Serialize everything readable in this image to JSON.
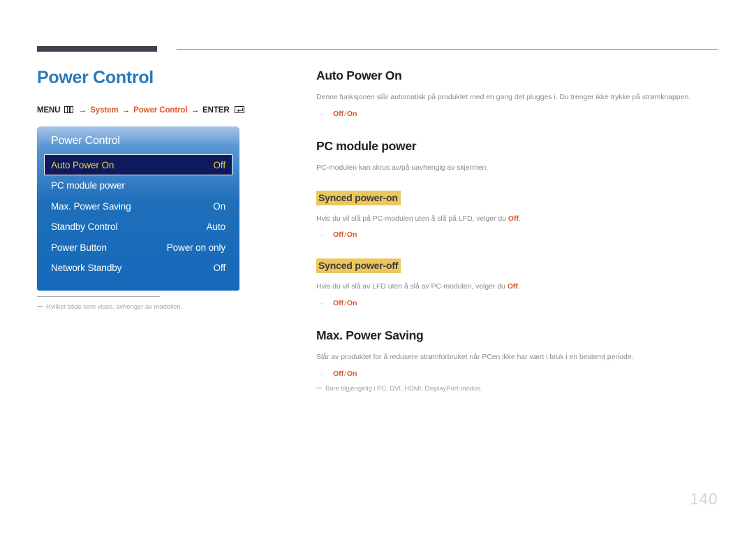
{
  "header": {
    "rule_color": "#454050"
  },
  "left": {
    "page_title": "Power Control",
    "breadcrumb": {
      "menu_label": "MENU",
      "menu_icon": "menu-grid-icon",
      "arrow": "→",
      "crumb1": "System",
      "crumb2": "Power Control",
      "enter_label": "ENTER",
      "enter_icon": "enter-return-icon"
    },
    "osd": {
      "title": "Power Control",
      "rows": [
        {
          "label": "Auto Power On",
          "value": "Off",
          "selected": true
        },
        {
          "label": "PC module power",
          "value": "",
          "selected": false
        },
        {
          "label": "Max. Power Saving",
          "value": "On",
          "selected": false
        },
        {
          "label": "Standby Control",
          "value": "Auto",
          "selected": false
        },
        {
          "label": "Power Button",
          "value": "Power on only",
          "selected": false
        },
        {
          "label": "Network Standby",
          "value": "Off",
          "selected": false
        }
      ],
      "accent_selected_bg": "#0d1a5c",
      "accent_selected_text": "#f5cf36",
      "panel_blue": "#1569ba"
    },
    "footnote": "Hvilket bilde som vises, avhenger av modellen."
  },
  "right": {
    "sections": [
      {
        "heading": "Auto Power On",
        "paragraph": "Denne funksjonen slår automatisk på produktet med en gang det plugges i. Du trenger ikke trykke på strømknappen.",
        "bullet": {
          "opt1": "Off",
          "sep": "/",
          "opt2": "On"
        }
      },
      {
        "heading": "PC module power",
        "paragraph": "PC-modulen kan skrus av/på uavhengig av skjermen."
      },
      {
        "sub_heading": "Synced power-on",
        "paragraph_pre": "Hvis du vil slå på PC-modulen uten å slå på LFD, velger du ",
        "paragraph_accent": "Off",
        "paragraph_post": ".",
        "bullet": {
          "opt1": "Off",
          "sep": "/",
          "opt2": "On"
        }
      },
      {
        "sub_heading": "Synced power-off",
        "paragraph_pre": "Hvis du vil slå av LFD uten å slå av PC-modulen, velger du ",
        "paragraph_accent": "Off",
        "paragraph_post": ".",
        "bullet": {
          "opt1": "Off",
          "sep": "/",
          "opt2": "On"
        }
      },
      {
        "heading": "Max. Power Saving",
        "paragraph": "Slår av produktet for å redusere strømforbruket når PCen ikke har vært i bruk i en bestemt periode.",
        "bullet": {
          "opt1": "Off",
          "sep": "/",
          "opt2": "On"
        },
        "footnote_pre": "Bare tilgjengelig i ",
        "footnote_modes": "PC, DVI, HDMI, DisplayPort",
        "footnote_post": "-modus."
      }
    ],
    "accent_color": "#e1562a",
    "highlight_color": "#ecc75c"
  },
  "page_number": "140"
}
